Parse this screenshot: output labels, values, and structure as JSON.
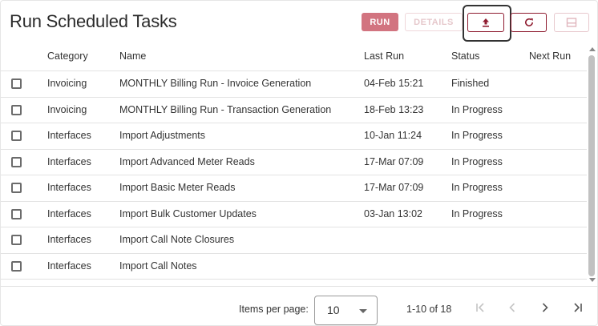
{
  "header": {
    "title": "Run Scheduled Tasks",
    "run_label": "RUN",
    "details_label": "DETAILS"
  },
  "icons": {
    "upload": "upload-icon",
    "refresh": "refresh-icon",
    "panel": "split-panel-icon"
  },
  "colors": {
    "accent": "#8e1b2f",
    "run_bg": "#d27480"
  },
  "table": {
    "columns": [
      "Category",
      "Name",
      "Last Run",
      "Status",
      "Next Run"
    ],
    "rows": [
      {
        "category": "Invoicing",
        "name": "MONTHLY Billing Run - Invoice Generation",
        "last_run": "04-Feb 15:21",
        "status": "Finished",
        "next_run": ""
      },
      {
        "category": "Invoicing",
        "name": "MONTHLY Billing Run - Transaction Generation",
        "last_run": "18-Feb 13:23",
        "status": "In Progress",
        "next_run": ""
      },
      {
        "category": "Interfaces",
        "name": "Import Adjustments",
        "last_run": "10-Jan 11:24",
        "status": "In Progress",
        "next_run": ""
      },
      {
        "category": "Interfaces",
        "name": "Import Advanced Meter Reads",
        "last_run": "17-Mar 07:09",
        "status": "In Progress",
        "next_run": ""
      },
      {
        "category": "Interfaces",
        "name": "Import Basic Meter Reads",
        "last_run": "17-Mar 07:09",
        "status": "In Progress",
        "next_run": ""
      },
      {
        "category": "Interfaces",
        "name": "Import Bulk Customer Updates",
        "last_run": "03-Jan 13:02",
        "status": "In Progress",
        "next_run": ""
      },
      {
        "category": "Interfaces",
        "name": "Import Call Note Closures",
        "last_run": "",
        "status": "",
        "next_run": ""
      },
      {
        "category": "Interfaces",
        "name": "Import Call Notes",
        "last_run": "",
        "status": "",
        "next_run": ""
      }
    ]
  },
  "footer": {
    "items_per_page_label": "Items per page:",
    "items_per_page_value": "10",
    "range_label": "1-10 of 18"
  }
}
